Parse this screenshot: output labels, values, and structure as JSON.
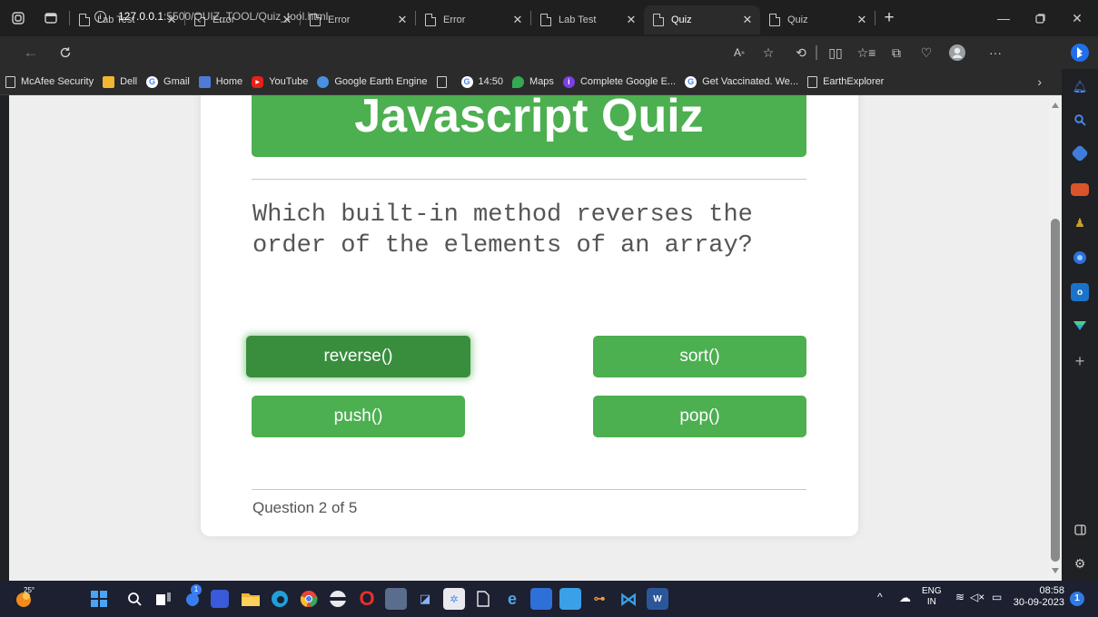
{
  "browser": {
    "tabs": [
      {
        "title": "Lab Test"
      },
      {
        "title": "Error"
      },
      {
        "title": "Error"
      },
      {
        "title": "Error"
      },
      {
        "title": "Lab Test"
      },
      {
        "title": "Quiz",
        "active": true
      },
      {
        "title": "Quiz"
      }
    ],
    "address": {
      "host": "127.0.0.1",
      "path": ":5500/QUIZ_TOOL/Quiz_tool.html"
    },
    "bookmarks": [
      {
        "label": "McAfee Security",
        "icon": "page-icon"
      },
      {
        "label": "Dell",
        "icon": "folder-icon"
      },
      {
        "label": "Gmail",
        "icon": "google-icon"
      },
      {
        "label": "Home",
        "icon": "home-icon"
      },
      {
        "label": "YouTube",
        "icon": "youtube-icon"
      },
      {
        "label": "Google Earth Engine",
        "icon": "earth-engine-icon"
      },
      {
        "label": "",
        "icon": "page-icon"
      },
      {
        "label": "14:50",
        "icon": "google-icon"
      },
      {
        "label": "Maps",
        "icon": "maps-icon"
      },
      {
        "label": "Complete Google E...",
        "icon": "course-icon"
      },
      {
        "label": "Get Vaccinated. We...",
        "icon": "google-icon"
      },
      {
        "label": "EarthExplorer",
        "icon": "page-icon"
      }
    ]
  },
  "quiz": {
    "title": "Javascript Quiz",
    "question": "Which built-in method reverses the order of the elements of an array?",
    "answers": [
      "reverse()",
      "sort()",
      "push()",
      "pop()"
    ],
    "selected_answer": "reverse()",
    "progress": "Question 2 of 5"
  },
  "taskbar": {
    "weather": "25°",
    "widgets_badge": "1",
    "language": "ENG",
    "region": "IN",
    "time": "08:58",
    "date": "30-09-2023",
    "notification_count": "1"
  },
  "colors": {
    "accent_green": "#4caf50",
    "selected_green": "#388e3c",
    "question_text": "#555555"
  }
}
